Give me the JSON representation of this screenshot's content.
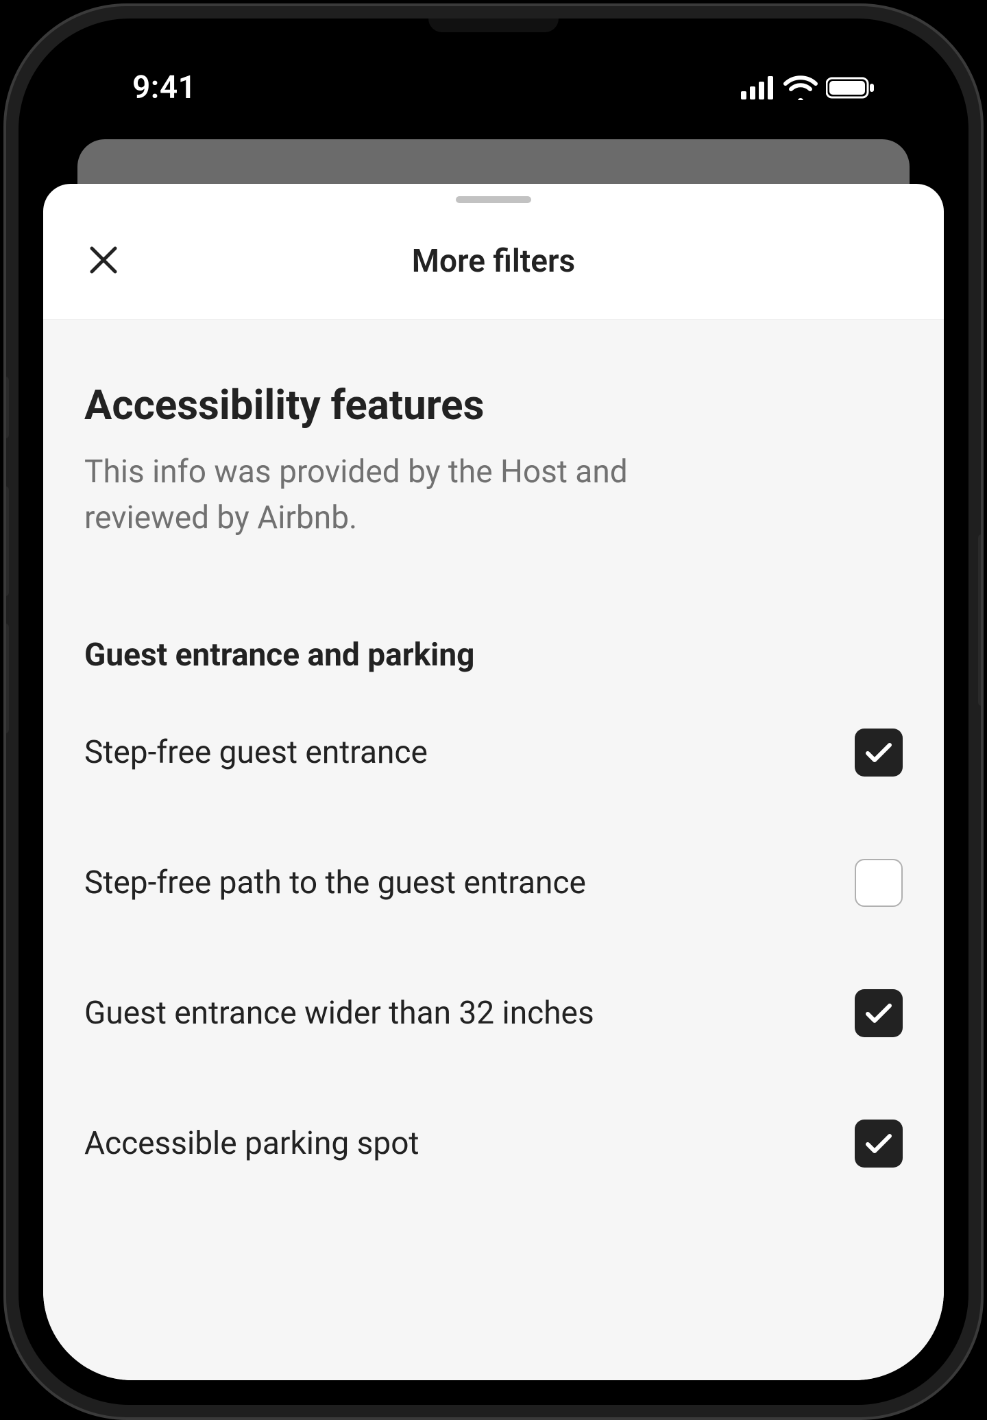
{
  "status_bar": {
    "time": "9:41",
    "icons": {
      "cellular": "cellular-icon",
      "wifi": "wifi-icon",
      "battery": "battery-icon"
    }
  },
  "sheet": {
    "title": "More filters",
    "close_icon": "close-icon",
    "section": {
      "heading": "Accessibility features",
      "subtext": "This info was provided by the Host and reviewed by Airbnb."
    },
    "group": {
      "heading": "Guest entrance and parking",
      "options": [
        {
          "label": "Step-free guest entrance",
          "checked": true
        },
        {
          "label": "Step-free path to the guest entrance",
          "checked": false
        },
        {
          "label": "Guest entrance wider than 32 inches",
          "checked": true
        },
        {
          "label": "Accessible parking spot",
          "checked": true
        }
      ]
    }
  }
}
